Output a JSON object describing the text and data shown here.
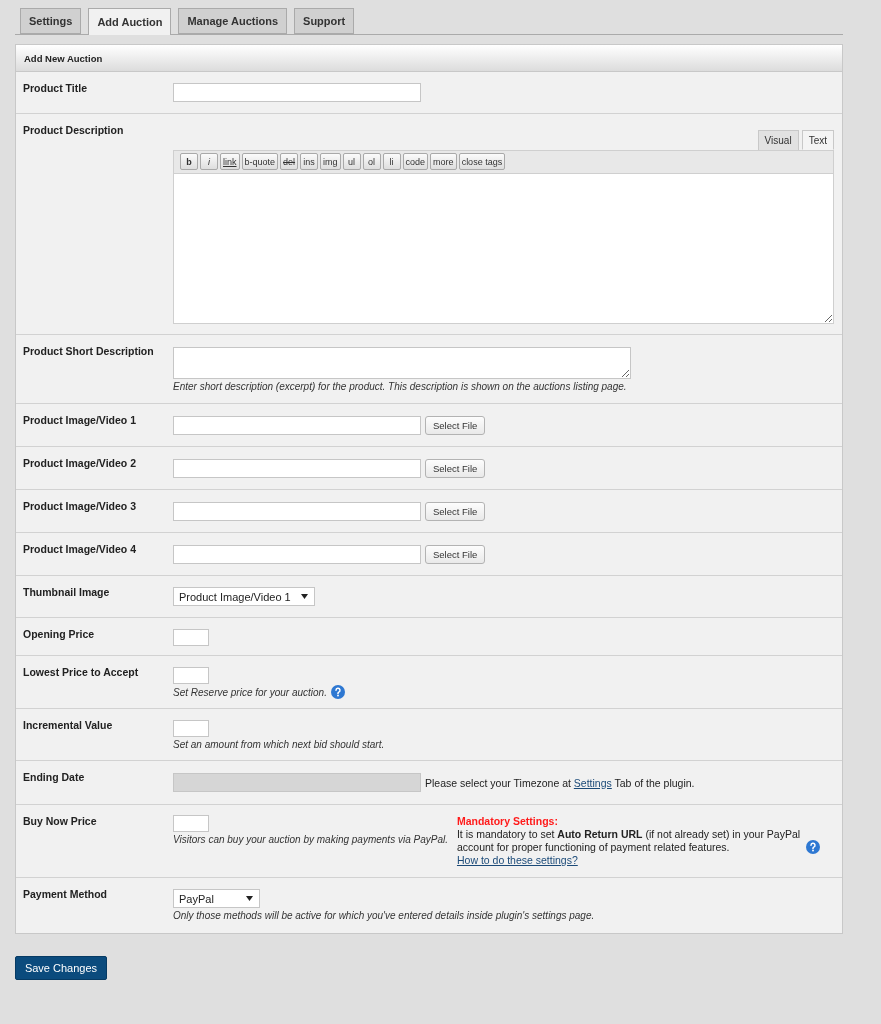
{
  "tabs": [
    {
      "label": "Settings",
      "selected": false
    },
    {
      "label": "Add Auction",
      "selected": true
    },
    {
      "label": "Manage Auctions",
      "selected": false
    },
    {
      "label": "Support",
      "selected": false
    }
  ],
  "panel": {
    "title": "Add New Auction",
    "rows": [
      {
        "kind": "text",
        "label": "Product Title"
      },
      {
        "kind": "editor",
        "label": "Product Description",
        "editor_tabs": [
          {
            "label": "Visual",
            "selected": false
          },
          {
            "label": "Text",
            "selected": true
          }
        ],
        "quicktags": [
          {
            "label": "b",
            "kind": "bold"
          },
          {
            "label": "i",
            "kind": "italic"
          },
          {
            "label": "link",
            "kind": "underline"
          },
          {
            "label": "b-quote",
            "kind": "plain"
          },
          {
            "label": "del",
            "kind": "strike"
          },
          {
            "label": "ins",
            "kind": "plain"
          },
          {
            "label": "img",
            "kind": "plain"
          },
          {
            "label": "ul",
            "kind": "plain"
          },
          {
            "label": "ol",
            "kind": "plain"
          },
          {
            "label": "li",
            "kind": "plain"
          },
          {
            "label": "code",
            "kind": "plain"
          },
          {
            "label": "more",
            "kind": "plain"
          },
          {
            "label": "close tags",
            "kind": "plain"
          }
        ]
      },
      {
        "kind": "textarea",
        "label": "Product Short Description",
        "description": "Enter short description (excerpt) for the product. This description is shown on the auctions listing page."
      },
      {
        "kind": "file",
        "label": "Product Image/Video 1",
        "button": "Select File"
      },
      {
        "kind": "file",
        "label": "Product Image/Video 2",
        "button": "Select File"
      },
      {
        "kind": "file",
        "label": "Product Image/Video 3",
        "button": "Select File"
      },
      {
        "kind": "file",
        "label": "Product Image/Video 4",
        "button": "Select File"
      },
      {
        "kind": "select",
        "label": "Thumbnail Image",
        "value": "Product Image/Video 1"
      },
      {
        "kind": "price",
        "label": "Opening Price"
      },
      {
        "kind": "price",
        "label": "Lowest Price to Accept",
        "description": "Set Reserve price for your auction.",
        "help": true
      },
      {
        "kind": "price",
        "label": "Incremental Value",
        "description": "Set an amount from which next bid should start."
      },
      {
        "kind": "date",
        "label": "Ending Date",
        "disabled": true,
        "note": {
          "before": "Please select your Timezone at",
          "link": "Settings",
          "after": "Tab of the plugin."
        }
      },
      {
        "kind": "buynow",
        "label": "Buy Now Price",
        "description": "Visitors can buy your auction by making payments via PayPal.",
        "notice": {
          "title": "Mandatory Settings:",
          "text": "It is mandatory to set **Auto Return URL** (if not already set) in your PayPal account for proper functioning of payment related features.",
          "help": true,
          "link": "How to do these settings?"
        }
      },
      {
        "kind": "select",
        "label": "Payment Method",
        "value": "PayPal",
        "description": "Only those methods will be active for which you've entered details inside plugin's settings page."
      }
    ]
  },
  "save_button": "Save Changes"
}
